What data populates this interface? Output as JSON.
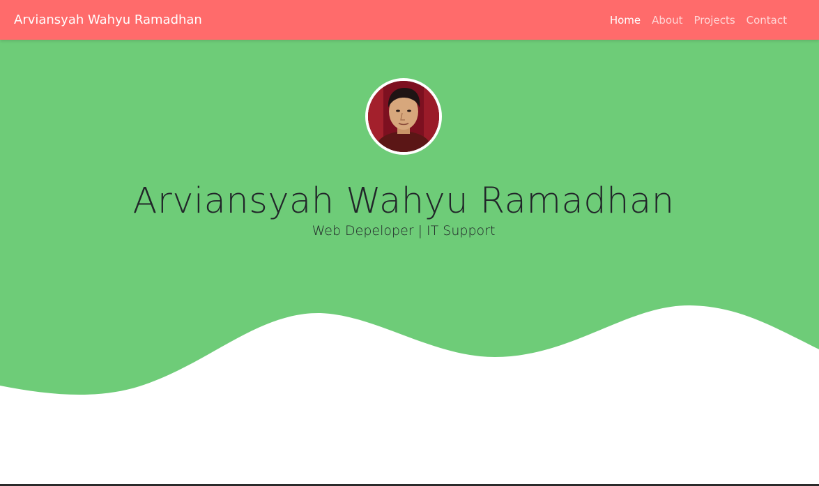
{
  "navbar": {
    "brand": "Arviansyah Wahyu Ramadhan",
    "links": [
      "Home",
      "About",
      "Projects",
      "Contact"
    ],
    "active": "Home"
  },
  "hero": {
    "name": "Arviansyah Wahyu Ramadhan",
    "subtitle": "Web Depeloper | IT Support"
  },
  "colors": {
    "navbar": "#ff6b6b",
    "hero": "#6ecc78",
    "text": "#212529"
  }
}
